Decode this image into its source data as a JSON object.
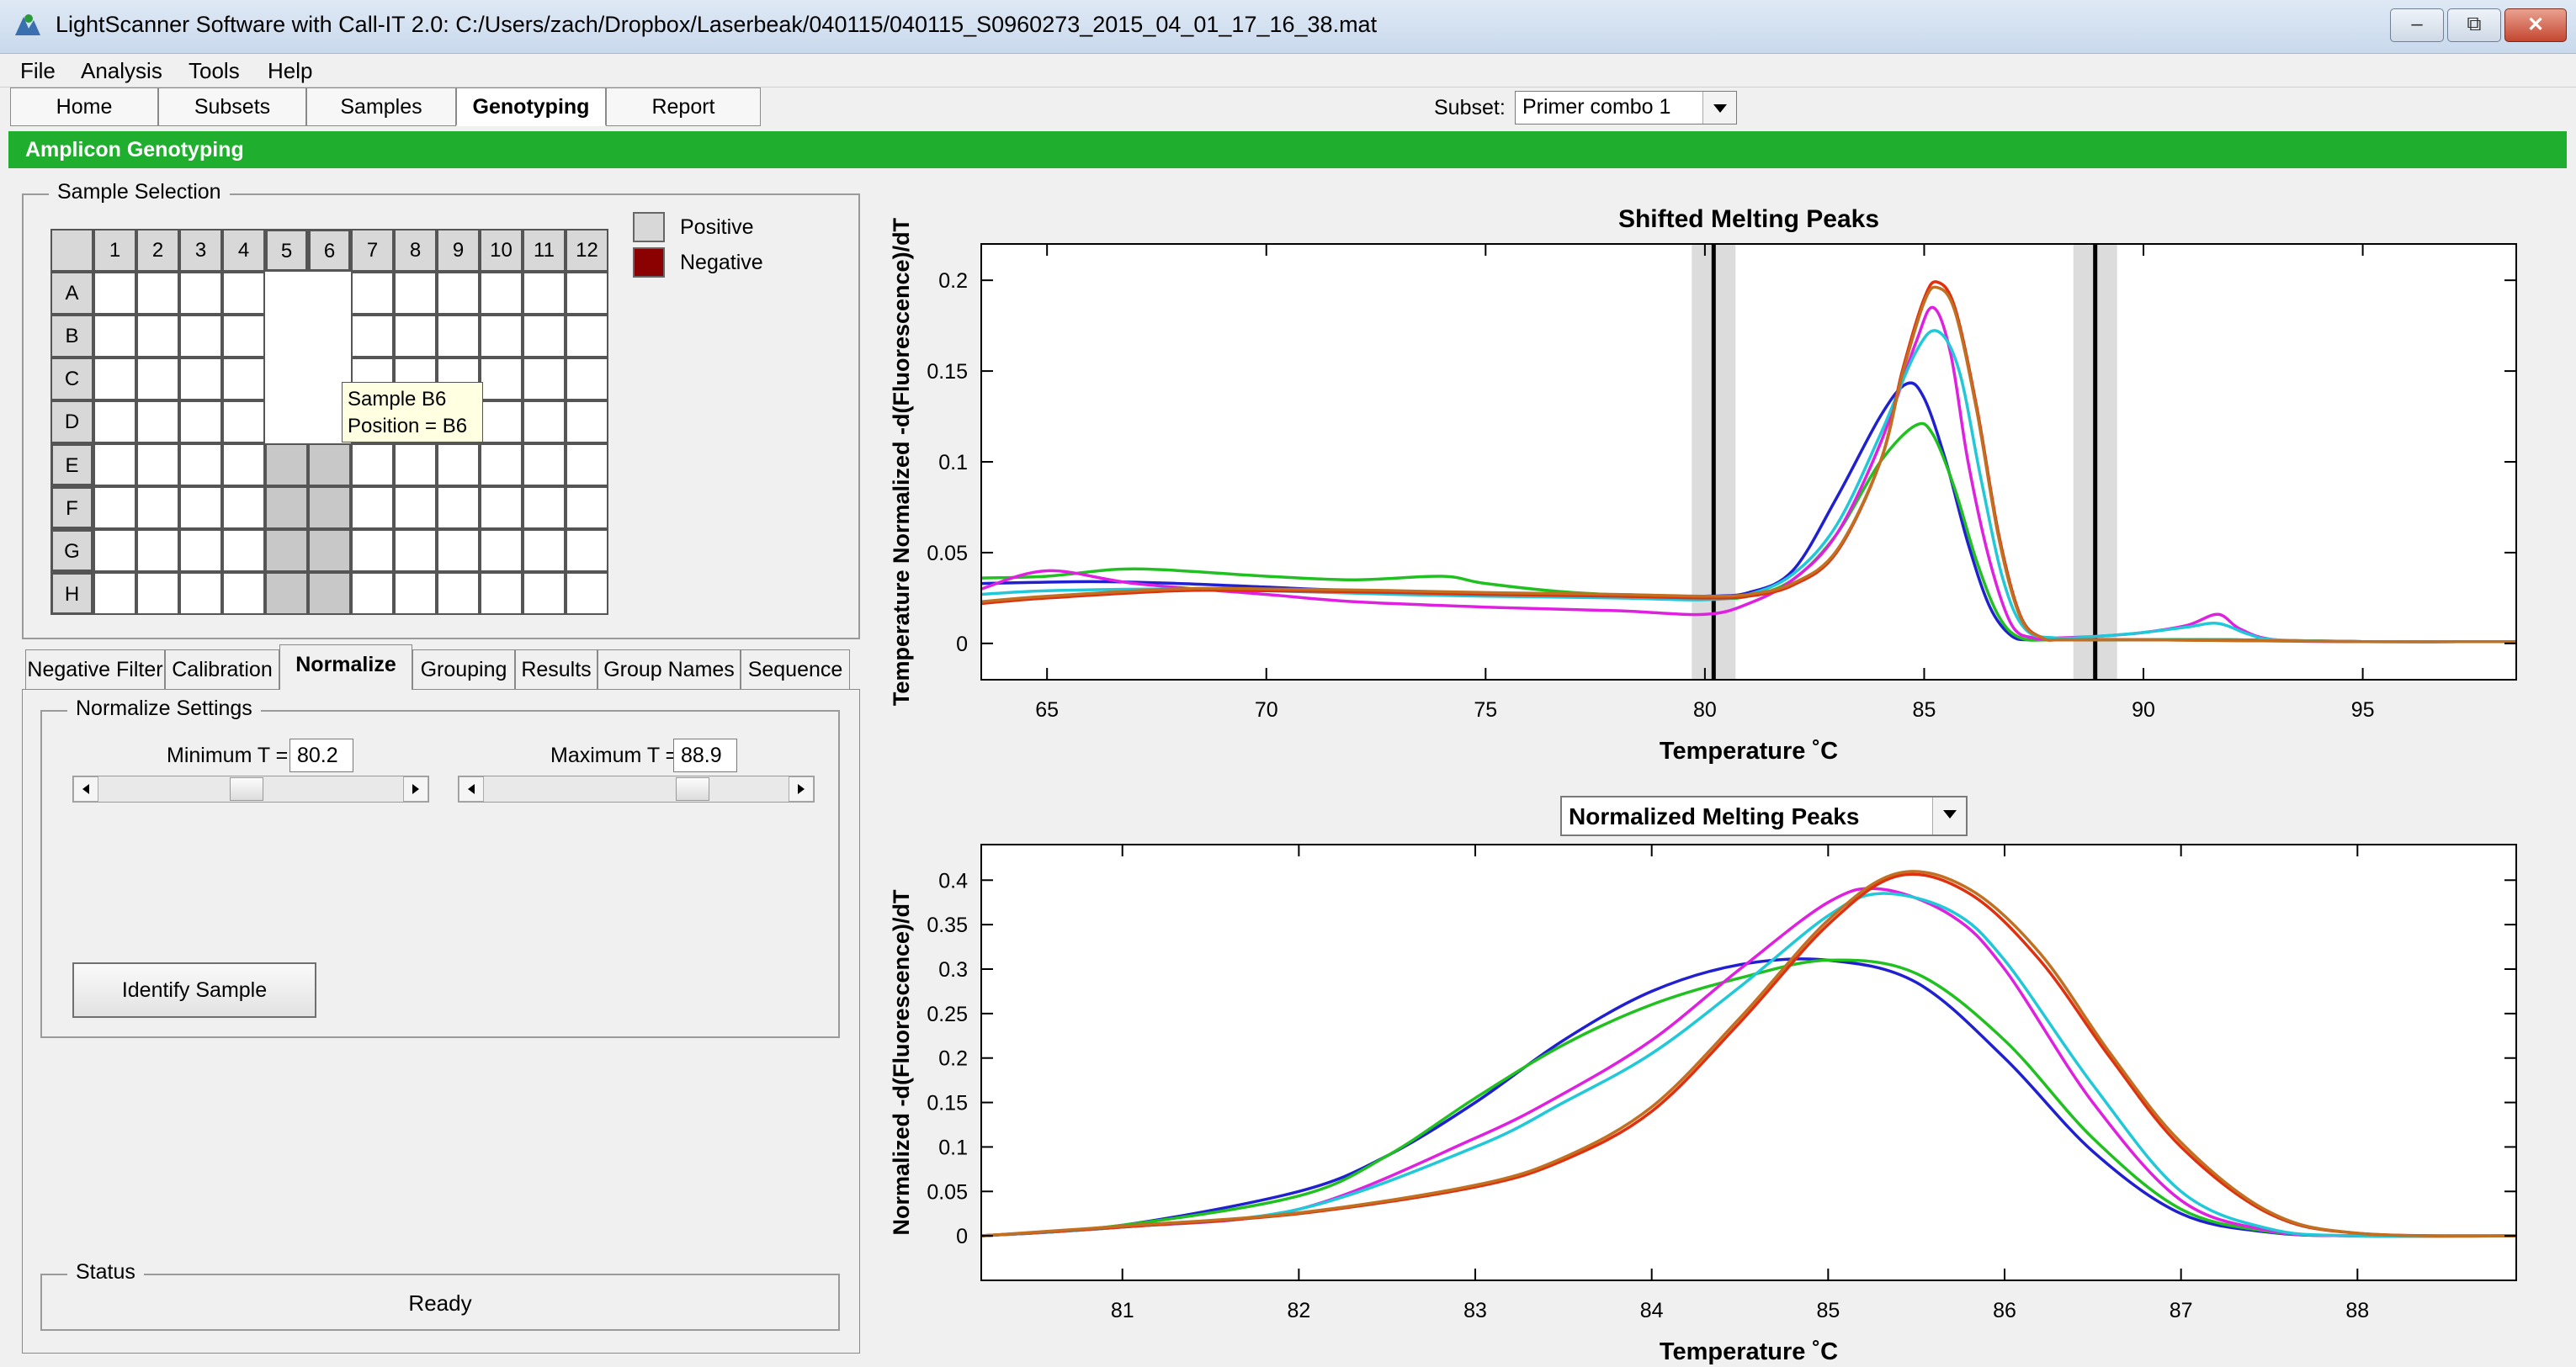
{
  "window": {
    "title": "LightScanner Software with Call-IT 2.0: C:/Users/zach/Dropbox/Laserbeak/040115/040115_S0960273_2015_04_01_17_16_38.mat"
  },
  "menu": [
    "File",
    "Analysis",
    "Tools",
    "Help"
  ],
  "toolbar": {
    "tabs": [
      "Home",
      "Subsets",
      "Samples",
      "Genotyping",
      "Report"
    ],
    "active": "Genotyping",
    "subset_label": "Subset:",
    "subset_value": "Primer combo 1"
  },
  "section_title": "Amplicon Genotyping",
  "sample_selection": {
    "title": "Sample Selection",
    "columns": [
      "1",
      "2",
      "3",
      "4",
      "5",
      "6",
      "7",
      "8",
      "9",
      "10",
      "11",
      "12"
    ],
    "rows": [
      "A",
      "B",
      "C",
      "D",
      "E",
      "F",
      "G",
      "H"
    ],
    "legend": {
      "positive": "Positive",
      "negative": "Negative",
      "positive_color": "#d8d8d8",
      "negative_color": "#8b0000"
    },
    "tooltip": {
      "line1": "Sample B6",
      "line2": "Position = B6"
    }
  },
  "subtabs": [
    "Negative Filter",
    "Calibration",
    "Normalize",
    "Grouping",
    "Results",
    "Group Names",
    "Sequence"
  ],
  "active_subtab": "Normalize",
  "normalize": {
    "title": "Normalize Settings",
    "min_label": "Minimum T =",
    "min_value": "80.2",
    "max_label": "Maximum T =",
    "max_value": "88.9",
    "identify_button": "Identify Sample"
  },
  "status": {
    "title": "Status",
    "text": "Ready"
  },
  "chart_data": [
    {
      "type": "line",
      "title": "Shifted Melting Peaks",
      "xlabel": "Temperature ˚C",
      "ylabel": "Temperature Normalized -d(Fluorescence)/dT",
      "xlim": [
        63.5,
        98.5
      ],
      "ylim": [
        -0.02,
        0.22
      ],
      "xticks": [
        "65",
        "70",
        "75",
        "80",
        "85",
        "90",
        "95"
      ],
      "yticks": [
        "0",
        "0.05",
        "0.1",
        "0.15",
        "0.2"
      ],
      "cursors": [
        80.2,
        88.9
      ],
      "series": [
        {
          "color": "#2020d0",
          "x": [
            63.5,
            66,
            68,
            70,
            72,
            75,
            78,
            80,
            81,
            82,
            83,
            84,
            84.6,
            85,
            85.5,
            86,
            86.5,
            87,
            87.5,
            88,
            90,
            92,
            95,
            98.5
          ],
          "y": [
            0.033,
            0.034,
            0.033,
            0.031,
            0.029,
            0.027,
            0.026,
            0.026,
            0.028,
            0.04,
            0.08,
            0.125,
            0.143,
            0.135,
            0.1,
            0.055,
            0.02,
            0.004,
            0.002,
            0.002,
            0.002,
            0.002,
            0.001,
            0.001
          ]
        },
        {
          "color": "#20c020",
          "x": [
            63.5,
            65,
            67,
            70,
            72,
            74,
            75,
            77,
            80,
            81,
            82,
            83,
            84,
            84.8,
            85.2,
            85.7,
            86.2,
            86.7,
            87.2,
            88,
            90,
            92,
            95,
            98.5
          ],
          "y": [
            0.036,
            0.037,
            0.041,
            0.037,
            0.035,
            0.037,
            0.033,
            0.028,
            0.025,
            0.026,
            0.035,
            0.06,
            0.1,
            0.12,
            0.115,
            0.085,
            0.045,
            0.015,
            0.003,
            0.002,
            0.002,
            0.002,
            0.001,
            0.001
          ]
        },
        {
          "color": "#e020e0",
          "x": [
            63.5,
            65,
            67,
            70,
            72,
            75,
            78,
            80,
            81,
            82,
            83,
            84,
            84.8,
            85.2,
            85.6,
            86,
            86.5,
            87,
            87.5,
            88,
            89,
            90,
            91,
            91.7,
            92.2,
            93,
            95,
            98.5
          ],
          "y": [
            0.03,
            0.04,
            0.033,
            0.027,
            0.023,
            0.02,
            0.018,
            0.016,
            0.022,
            0.035,
            0.06,
            0.11,
            0.165,
            0.185,
            0.16,
            0.1,
            0.045,
            0.01,
            0.003,
            0.003,
            0.004,
            0.006,
            0.01,
            0.016,
            0.008,
            0.002,
            0.001,
            0.001
          ]
        },
        {
          "color": "#20c8d8",
          "x": [
            63.5,
            65,
            68,
            70,
            73,
            75,
            78,
            80,
            81,
            82,
            83,
            84,
            84.8,
            85.3,
            85.8,
            86.3,
            86.8,
            87.3,
            88,
            89,
            90,
            91,
            91.7,
            92.4,
            93,
            95,
            98.5
          ],
          "y": [
            0.027,
            0.029,
            0.03,
            0.029,
            0.027,
            0.026,
            0.025,
            0.024,
            0.027,
            0.038,
            0.065,
            0.115,
            0.16,
            0.172,
            0.15,
            0.09,
            0.035,
            0.008,
            0.003,
            0.004,
            0.006,
            0.009,
            0.011,
            0.005,
            0.002,
            0.001,
            0.001
          ]
        },
        {
          "color": "#e03010",
          "x": [
            63.5,
            65,
            68,
            70,
            73,
            75,
            78,
            80,
            81,
            82,
            83,
            84,
            84.5,
            85,
            85.3,
            85.7,
            86.2,
            86.7,
            87.2,
            87.7,
            88.2,
            90,
            95,
            98.5
          ],
          "y": [
            0.022,
            0.025,
            0.029,
            0.029,
            0.028,
            0.027,
            0.026,
            0.025,
            0.026,
            0.032,
            0.05,
            0.1,
            0.15,
            0.19,
            0.199,
            0.185,
            0.13,
            0.06,
            0.015,
            0.003,
            0.002,
            0.002,
            0.001,
            0.001
          ]
        },
        {
          "color": "#c07020",
          "x": [
            63.5,
            65,
            68,
            70,
            73,
            75,
            78,
            80,
            81,
            82,
            83,
            84,
            84.5,
            85,
            85.3,
            85.7,
            86.2,
            86.7,
            87.2,
            87.7,
            88.2,
            90,
            95,
            98.5
          ],
          "y": [
            0.023,
            0.026,
            0.03,
            0.03,
            0.029,
            0.028,
            0.027,
            0.026,
            0.027,
            0.033,
            0.051,
            0.1,
            0.148,
            0.188,
            0.196,
            0.183,
            0.128,
            0.058,
            0.014,
            0.003,
            0.002,
            0.002,
            0.001,
            0.001
          ]
        }
      ]
    },
    {
      "type": "line",
      "title": "Normalized Melting Peaks",
      "xlabel": "Temperature ˚C",
      "ylabel": "Normalized -d(Fluorescence)/dT",
      "xlim": [
        80.2,
        88.9
      ],
      "ylim": [
        -0.05,
        0.44
      ],
      "xticks": [
        "81",
        "82",
        "83",
        "84",
        "85",
        "86",
        "87",
        "88"
      ],
      "yticks": [
        "0",
        "0.05",
        "0.1",
        "0.15",
        "0.2",
        "0.25",
        "0.3",
        "0.35",
        "0.4"
      ],
      "series": [
        {
          "color": "#2020d0",
          "x": [
            80.2,
            81,
            82,
            82.5,
            83,
            83.5,
            84,
            84.5,
            85,
            85.5,
            86,
            86.5,
            87,
            87.5,
            88,
            88.9
          ],
          "y": [
            0,
            0.012,
            0.05,
            0.09,
            0.15,
            0.22,
            0.275,
            0.305,
            0.31,
            0.285,
            0.2,
            0.095,
            0.025,
            0.004,
            0,
            0
          ]
        },
        {
          "color": "#20c020",
          "x": [
            80.2,
            81,
            82,
            82.5,
            83,
            83.5,
            84,
            84.5,
            85,
            85.5,
            86,
            86.5,
            87,
            87.5,
            88,
            88.9
          ],
          "y": [
            0,
            0.012,
            0.045,
            0.09,
            0.155,
            0.215,
            0.26,
            0.29,
            0.31,
            0.295,
            0.22,
            0.11,
            0.03,
            0.005,
            0,
            0
          ]
        },
        {
          "color": "#e020e0",
          "x": [
            80.2,
            81,
            82,
            83,
            83.5,
            84,
            84.5,
            85,
            85.3,
            85.7,
            86,
            86.5,
            87,
            87.5,
            88,
            88.9
          ],
          "y": [
            0,
            0.01,
            0.03,
            0.11,
            0.16,
            0.22,
            0.3,
            0.375,
            0.39,
            0.36,
            0.3,
            0.15,
            0.04,
            0.006,
            0,
            0
          ]
        },
        {
          "color": "#20c8d8",
          "x": [
            80.2,
            81,
            82,
            83,
            83.5,
            84,
            84.5,
            85,
            85.3,
            85.7,
            86,
            86.5,
            87,
            87.5,
            88,
            88.9
          ],
          "y": [
            0,
            0.01,
            0.03,
            0.1,
            0.15,
            0.205,
            0.28,
            0.36,
            0.385,
            0.365,
            0.31,
            0.17,
            0.05,
            0.008,
            0,
            0
          ]
        },
        {
          "color": "#e03010",
          "x": [
            80.2,
            81,
            82,
            83,
            83.5,
            84,
            84.5,
            85,
            85.4,
            85.8,
            86.2,
            86.6,
            87,
            87.5,
            88,
            88.9
          ],
          "y": [
            0,
            0.01,
            0.025,
            0.055,
            0.085,
            0.14,
            0.24,
            0.35,
            0.405,
            0.385,
            0.31,
            0.2,
            0.1,
            0.025,
            0.003,
            0
          ]
        },
        {
          "color": "#c07020",
          "x": [
            80.2,
            81,
            82,
            83,
            83.5,
            84,
            84.5,
            85,
            85.4,
            85.8,
            86.2,
            86.6,
            87,
            87.5,
            88,
            88.9
          ],
          "y": [
            0,
            0.011,
            0.026,
            0.057,
            0.088,
            0.145,
            0.245,
            0.355,
            0.408,
            0.39,
            0.318,
            0.205,
            0.105,
            0.027,
            0.003,
            0
          ]
        }
      ]
    }
  ]
}
